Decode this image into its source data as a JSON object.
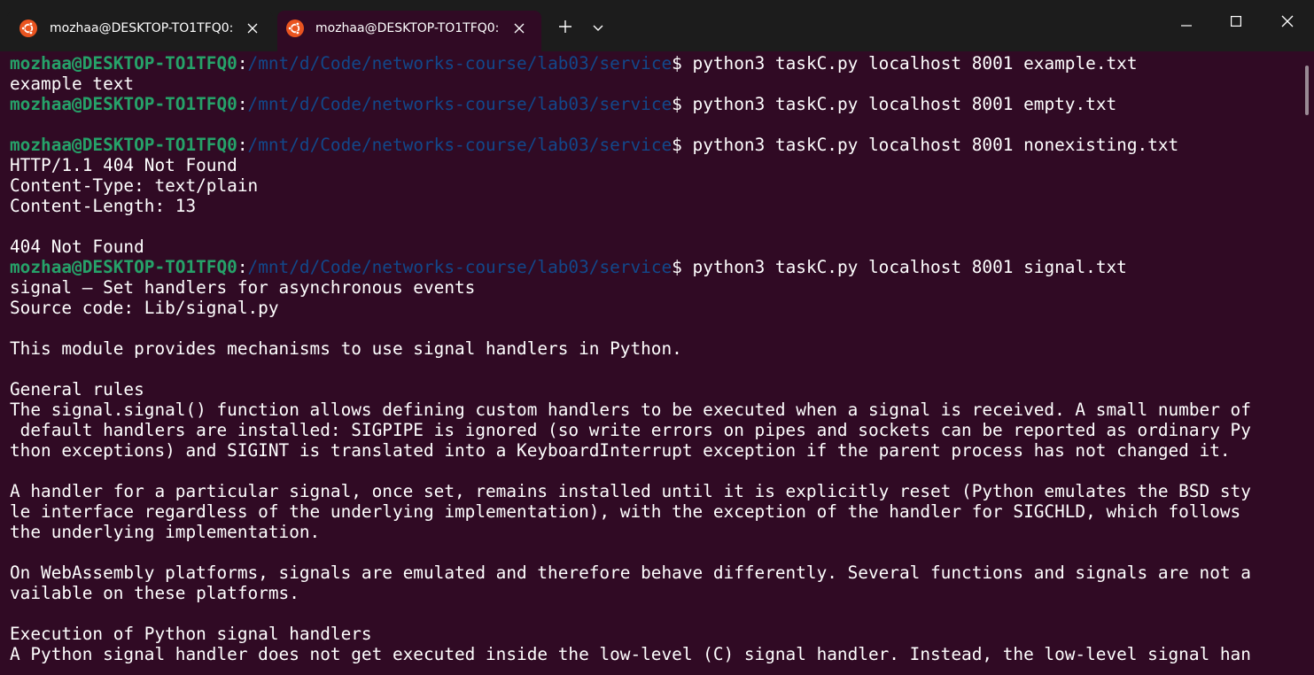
{
  "tabs": [
    {
      "title": "mozhaa@DESKTOP-TO1TFQ0: /",
      "active": false,
      "icon": "ubuntu-icon"
    },
    {
      "title": "mozhaa@DESKTOP-TO1TFQ0: ",
      "active": true,
      "icon": "ubuntu-icon"
    }
  ],
  "window_controls": {
    "new_tab": "new-tab-icon",
    "dropdown": "chevron-down-icon",
    "minimize": "minimize-icon",
    "maximize": "maximize-icon",
    "close": "close-icon"
  },
  "colors": {
    "terminal_bg": "#300a24",
    "titlebar_bg": "#1c1c1c",
    "prompt_user": "#26a269",
    "prompt_path": "#12488b",
    "text": "#ffffff",
    "ubuntu_orange": "#e95420"
  },
  "prompt": {
    "user": "mozhaa@DESKTOP-TO1TFQ0",
    "colon": ":",
    "path": "/mnt/d/Code/networks-course/lab03/service",
    "dollar": "$"
  },
  "terminal": {
    "lines": [
      {
        "type": "prompt",
        "command": " python3 taskC.py localhost 8001 example.txt"
      },
      {
        "type": "text",
        "text": "example text"
      },
      {
        "type": "prompt",
        "command": " python3 taskC.py localhost 8001 empty.txt"
      },
      {
        "type": "text",
        "text": ""
      },
      {
        "type": "prompt",
        "command": " python3 taskC.py localhost 8001 nonexisting.txt"
      },
      {
        "type": "text",
        "text": "HTTP/1.1 404 Not Found"
      },
      {
        "type": "text",
        "text": "Content-Type: text/plain"
      },
      {
        "type": "text",
        "text": "Content-Length: 13"
      },
      {
        "type": "text",
        "text": ""
      },
      {
        "type": "text",
        "text": "404 Not Found"
      },
      {
        "type": "prompt",
        "command": " python3 taskC.py localhost 8001 signal.txt"
      },
      {
        "type": "text",
        "text": "signal — Set handlers for asynchronous events"
      },
      {
        "type": "text",
        "text": "Source code: Lib/signal.py"
      },
      {
        "type": "text",
        "text": ""
      },
      {
        "type": "text",
        "text": "This module provides mechanisms to use signal handlers in Python."
      },
      {
        "type": "text",
        "text": ""
      },
      {
        "type": "text",
        "text": "General rules"
      },
      {
        "type": "text",
        "text": "The signal.signal() function allows defining custom handlers to be executed when a signal is received. A small number of"
      },
      {
        "type": "text",
        "text": " default handlers are installed: SIGPIPE is ignored (so write errors on pipes and sockets can be reported as ordinary Py"
      },
      {
        "type": "text",
        "text": "thon exceptions) and SIGINT is translated into a KeyboardInterrupt exception if the parent process has not changed it."
      },
      {
        "type": "text",
        "text": ""
      },
      {
        "type": "text",
        "text": "A handler for a particular signal, once set, remains installed until it is explicitly reset (Python emulates the BSD sty"
      },
      {
        "type": "text",
        "text": "le interface regardless of the underlying implementation), with the exception of the handler for SIGCHLD, which follows"
      },
      {
        "type": "text",
        "text": "the underlying implementation."
      },
      {
        "type": "text",
        "text": ""
      },
      {
        "type": "text",
        "text": "On WebAssembly platforms, signals are emulated and therefore behave differently. Several functions and signals are not a"
      },
      {
        "type": "text",
        "text": "vailable on these platforms."
      },
      {
        "type": "text",
        "text": ""
      },
      {
        "type": "text",
        "text": "Execution of Python signal handlers"
      },
      {
        "type": "text",
        "text": "A Python signal handler does not get executed inside the low-level (C) signal handler. Instead, the low-level signal han"
      }
    ]
  }
}
